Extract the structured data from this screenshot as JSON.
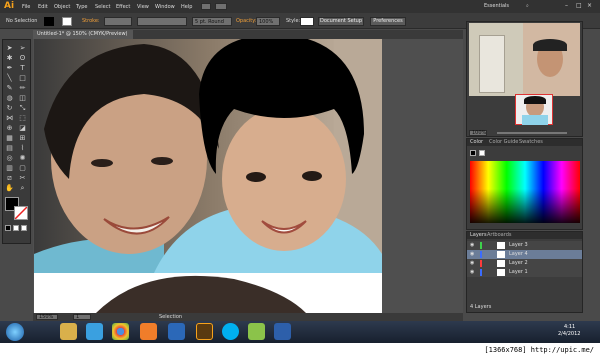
{
  "app": {
    "logo": "Ai"
  },
  "menu": [
    "File",
    "Edit",
    "Object",
    "Type",
    "Select",
    "Effect",
    "View",
    "Window",
    "Help"
  ],
  "workspace": "Essentials",
  "control": {
    "selection": "No Selection",
    "stroke_label": "Stroke:",
    "brush": "5 pt. Round",
    "opacity_label": "Opacity:",
    "opacity": "100%",
    "style_label": "Style:",
    "doc_setup": "Document Setup",
    "preferences": "Preferences"
  },
  "document": {
    "tab": "Untitled-1* @ 150% (CMYK/Preview)",
    "zoom": "150%",
    "status": "Selection",
    "page": "1"
  },
  "navigator": {
    "zoom": "100%"
  },
  "color_panel": {
    "tabs": [
      "Color",
      "Color Guide",
      "Swatches"
    ]
  },
  "layers_panel": {
    "tabs": [
      "Layers",
      "Artboards"
    ],
    "layers": [
      {
        "name": "Layer 3",
        "color": "#3ed14b"
      },
      {
        "name": "Layer 4",
        "color": "#3b6cff"
      },
      {
        "name": "Layer 2",
        "color": "#ff3b3b"
      },
      {
        "name": "Layer 1",
        "color": "#3b6cff"
      }
    ],
    "count": "4 Layers"
  },
  "tray": {
    "time": "4:11",
    "date": "2/4/2012"
  },
  "watermark": {
    "text": "[1366x768] http://upic.me/"
  },
  "taskbar_icons": [
    "start-orb",
    "files",
    "ie",
    "chrome",
    "media",
    "photoshop",
    "illustrator",
    "skype",
    "chat",
    "word"
  ]
}
